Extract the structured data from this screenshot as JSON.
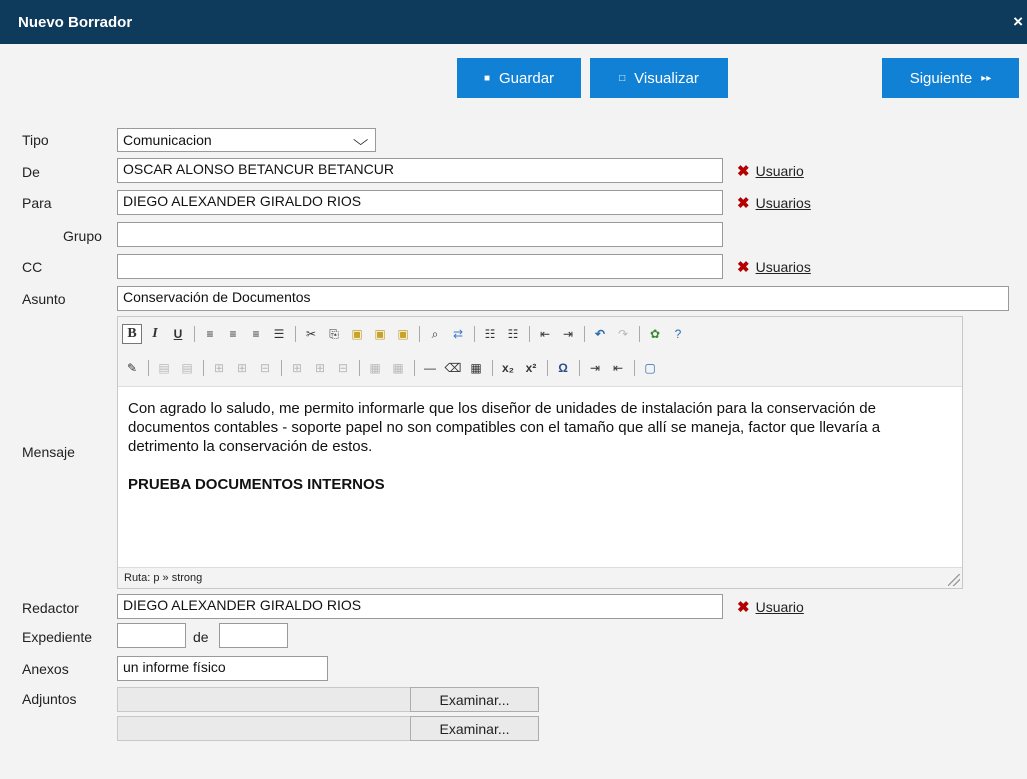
{
  "window": {
    "title": "Nuevo Borrador",
    "close_glyph": "×"
  },
  "toolbar": {
    "save_label": "Guardar",
    "preview_label": "Visualizar",
    "next_label": "Siguiente",
    "save_icon": "floppy-icon",
    "preview_icon": "preview-icon",
    "next_icon": "fast-forward-icon"
  },
  "form": {
    "tipo": {
      "label": "Tipo",
      "value": "Comunicacion"
    },
    "de": {
      "label": "De",
      "value": "OSCAR ALONSO BETANCUR BETANCUR",
      "link": "Usuario"
    },
    "para": {
      "label": "Para",
      "value": "DIEGO ALEXANDER GIRALDO RIOS",
      "link": "Usuarios"
    },
    "grupo": {
      "label": "Grupo",
      "value": ""
    },
    "cc": {
      "label": "CC",
      "value": "",
      "link": "Usuarios"
    },
    "asunto": {
      "label": "Asunto",
      "value": "Conservación de Documentos"
    },
    "mensaje": {
      "label": "Mensaje",
      "paragraph": "Con agrado lo saludo, me permito informarle que los diseñor de unidades de instalación para la conservación de documentos contables - soporte papel no son compatibles con el tamaño que allí se maneja, factor que llevaría a detrimento la conservación de estos.",
      "bold_line": "PRUEBA DOCUMENTOS INTERNOS",
      "path": "Ruta: p » strong"
    },
    "redactor": {
      "label": "Redactor",
      "value": "DIEGO ALEXANDER GIRALDO RIOS",
      "link": "Usuario"
    },
    "expediente": {
      "label": "Expediente",
      "value1": "",
      "de_label": "de",
      "value2": ""
    },
    "anexos": {
      "label": "Anexos",
      "value": "un informe físico"
    },
    "adjuntos": {
      "label": "Adjuntos",
      "browse_label": "Examinar..."
    }
  },
  "colors": {
    "titlebar": "#0e3a5c",
    "button": "#1181d6",
    "remove_x": "#b30000"
  }
}
